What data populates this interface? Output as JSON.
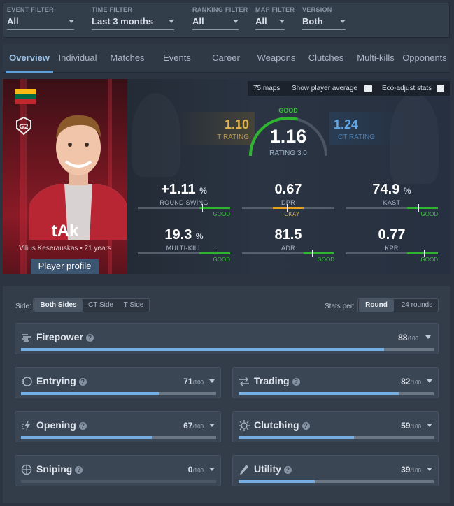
{
  "filters": [
    {
      "label": "EVENT FILTER",
      "value": "All"
    },
    {
      "label": "TIME FILTER",
      "value": "Last 3 months"
    },
    {
      "label": "RANKING FILTER",
      "value": "All"
    },
    {
      "label": "MAP FILTER",
      "value": "All"
    },
    {
      "label": "VERSION",
      "value": "Both"
    }
  ],
  "tabs": [
    {
      "label": "Overview",
      "active": true
    },
    {
      "label": "Individual"
    },
    {
      "label": "Matches"
    },
    {
      "label": "Events"
    },
    {
      "label": "Career"
    },
    {
      "label": "Weapons"
    },
    {
      "label": "Clutches"
    },
    {
      "label": "Multi-kills"
    },
    {
      "label": "Opponents"
    }
  ],
  "player": {
    "nickname": "tAk",
    "realname": "Vilius Keserauskas",
    "age": "21 years",
    "profile_button": "Player profile",
    "flag_colors": [
      "#FDB913",
      "#006A44",
      "#C1272D"
    ]
  },
  "options": {
    "maps": "75 maps",
    "show_average": "Show player average",
    "eco_adjust": "Eco-adjust stats"
  },
  "ratings": {
    "t_value": "1.10",
    "t_label": "T RATING",
    "main_value": "1.16",
    "main_label": "RATING 3.0",
    "main_grade": "GOOD",
    "main_fill": 0.58,
    "ct_value": "1.24",
    "ct_label": "CT RATING"
  },
  "stats": [
    {
      "value": "+1.11",
      "unit": "%",
      "label": "ROUND SWING",
      "grade": "GOOD"
    },
    {
      "value": "0.67",
      "unit": "",
      "label": "DPR",
      "grade": "OKAY"
    },
    {
      "value": "74.9",
      "unit": "%",
      "label": "KAST",
      "grade": "GOOD"
    },
    {
      "value": "19.3",
      "unit": "%",
      "label": "MULTI-KILL",
      "grade": "GOOD"
    },
    {
      "value": "81.5",
      "unit": "",
      "label": "ADR",
      "grade": "GOOD"
    },
    {
      "value": "0.77",
      "unit": "",
      "label": "KPR",
      "grade": "GOOD"
    }
  ],
  "bottom": {
    "side_label": "Side:",
    "sides": [
      "Both Sides",
      "CT Side",
      "T Side"
    ],
    "stats_per_label": "Stats per:",
    "per": [
      "Round",
      "24 rounds"
    ],
    "out_of": "/100",
    "categories": [
      {
        "name": "Firepower",
        "score": "88",
        "level": 0.88,
        "icon": "firepower-icon"
      },
      {
        "name": "Entrying",
        "score": "71",
        "level": 0.71,
        "icon": "entrying-icon"
      },
      {
        "name": "Trading",
        "score": "82",
        "level": 0.82,
        "icon": "trading-icon"
      },
      {
        "name": "Opening",
        "score": "67",
        "level": 0.67,
        "icon": "opening-icon"
      },
      {
        "name": "Clutching",
        "score": "59",
        "level": 0.59,
        "icon": "clutching-icon"
      },
      {
        "name": "Sniping",
        "score": "0",
        "level": 0.0,
        "icon": "sniping-icon"
      },
      {
        "name": "Utility",
        "score": "39",
        "level": 0.39,
        "icon": "utility-icon"
      }
    ]
  }
}
